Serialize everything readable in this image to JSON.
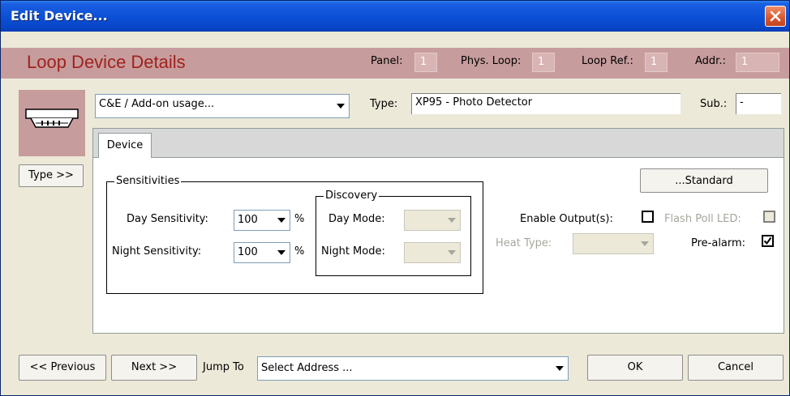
{
  "window": {
    "title": "Edit Device..."
  },
  "header": {
    "title": "Loop Device Details",
    "panel_label": "Panel:",
    "panel_value": "1",
    "phys_loop_label": "Phys. Loop:",
    "phys_loop_value": "1",
    "loop_ref_label": "Loop Ref.:",
    "loop_ref_value": "1",
    "addr_label": "Addr.:",
    "addr_value": "1"
  },
  "device_row": {
    "usage_select_value": "C&E / Add-on usage...",
    "type_label": "Type:",
    "type_value": "XP95 - Photo Detector",
    "sub_label": "Sub.:",
    "sub_value": "-",
    "type_button": "Type >>"
  },
  "tabs": [
    {
      "label": "Device",
      "selected": true
    }
  ],
  "sensitivities": {
    "legend": "Sensitivities",
    "day_label": "Day Sensitivity:",
    "day_value": "100",
    "night_label": "Night Sensitivity:",
    "night_value": "100",
    "unit": "%"
  },
  "discovery": {
    "legend": "Discovery",
    "day_mode_label": "Day Mode:",
    "day_mode_value": "",
    "night_mode_label": "Night Mode:",
    "night_mode_value": ""
  },
  "options": {
    "standard_button": "...Standard",
    "enable_outputs_label": "Enable Output(s):",
    "enable_outputs_checked": false,
    "flash_poll_led_label": "Flash Poll LED:",
    "flash_poll_led_checked": false,
    "heat_type_label": "Heat Type:",
    "heat_type_value": "",
    "prealarm_label": "Pre-alarm:",
    "prealarm_checked": true
  },
  "footer": {
    "previous_button": "<< Previous",
    "next_button": "Next >>",
    "jump_to_label": "Jump To",
    "jump_to_value": "Select Address ...",
    "ok_button": "OK",
    "cancel_button": "Cancel"
  },
  "colors": {
    "title_bar": "#0b4fd6",
    "header_band": "#c79c9c",
    "header_title": "#a0221f",
    "dialog_bg": "#ece9d8"
  },
  "icons": [
    "close-icon",
    "detector-device-icon",
    "dropdown-arrow-icon",
    "checkmark-icon"
  ]
}
